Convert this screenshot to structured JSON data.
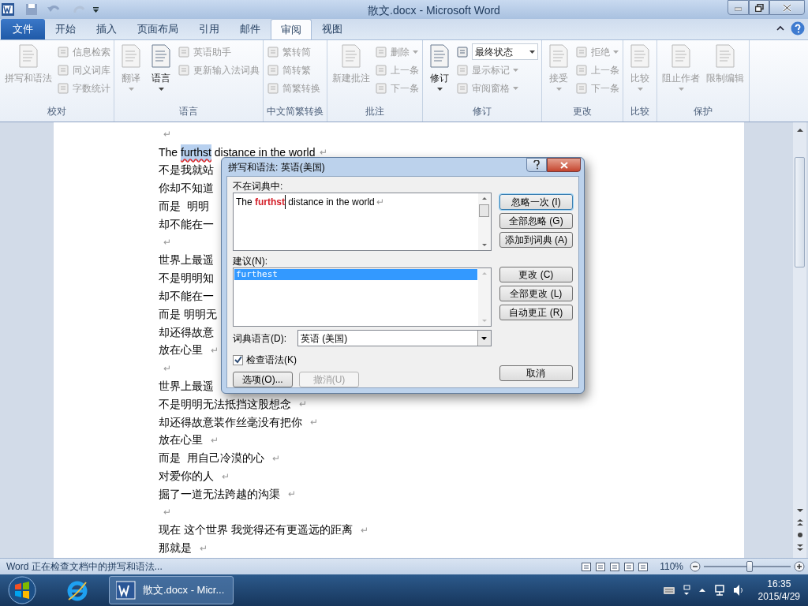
{
  "window": {
    "title": "散文.docx - Microsoft Word"
  },
  "tabs": [
    {
      "label": "文件",
      "kind": "file",
      "selected": false
    },
    {
      "label": "开始",
      "kind": "tab",
      "selected": false
    },
    {
      "label": "插入",
      "kind": "tab",
      "selected": false
    },
    {
      "label": "页面布局",
      "kind": "tab",
      "selected": false
    },
    {
      "label": "引用",
      "kind": "tab",
      "selected": false
    },
    {
      "label": "邮件",
      "kind": "tab",
      "selected": false
    },
    {
      "label": "审阅",
      "kind": "tab",
      "selected": true
    },
    {
      "label": "视图",
      "kind": "tab",
      "selected": false
    }
  ],
  "ribbon_groups": [
    {
      "label": "校对",
      "items": [
        {
          "label": "拼写和语法",
          "kind": "large",
          "disabled": true,
          "menu": false
        },
        {
          "label": "信息检索",
          "kind": "small",
          "disabled": true,
          "menu": false
        },
        {
          "label": "同义词库",
          "kind": "small",
          "disabled": true,
          "menu": false
        },
        {
          "label": "字数统计",
          "kind": "small",
          "disabled": true,
          "menu": false
        }
      ]
    },
    {
      "label": "语言",
      "items": [
        {
          "label": "翻译",
          "kind": "large",
          "disabled": true,
          "menu": true
        },
        {
          "label": "语言",
          "kind": "large",
          "disabled": false,
          "menu": true
        },
        {
          "label": "英语助手",
          "kind": "small",
          "disabled": true,
          "menu": false
        },
        {
          "label": "更新输入法词典",
          "kind": "small",
          "disabled": true,
          "menu": false
        }
      ]
    },
    {
      "label": "中文简繁转换",
      "items": [
        {
          "label": "繁转简",
          "kind": "small",
          "disabled": true,
          "menu": false
        },
        {
          "label": "简转繁",
          "kind": "small",
          "disabled": true,
          "menu": false
        },
        {
          "label": "简繁转换",
          "kind": "small",
          "disabled": true,
          "menu": false
        }
      ]
    },
    {
      "label": "批注",
      "items": [
        {
          "label": "新建批注",
          "kind": "large",
          "disabled": true,
          "menu": false
        },
        {
          "label": "删除",
          "kind": "small",
          "disabled": true,
          "menu": true
        },
        {
          "label": "上一条",
          "kind": "small",
          "disabled": true,
          "menu": false
        },
        {
          "label": "下一条",
          "kind": "small",
          "disabled": true,
          "menu": false
        }
      ]
    },
    {
      "label": "修订",
      "items": [
        {
          "label": "修订",
          "kind": "large",
          "disabled": false,
          "menu": true
        },
        {
          "label": "最终状态",
          "kind": "dropdown",
          "disabled": false,
          "menu": true
        },
        {
          "label": "显示标记",
          "kind": "small",
          "disabled": true,
          "menu": true
        },
        {
          "label": "审阅窗格",
          "kind": "small",
          "disabled": true,
          "menu": true
        }
      ]
    },
    {
      "label": "更改",
      "items": [
        {
          "label": "接受",
          "kind": "large",
          "disabled": true,
          "menu": true
        },
        {
          "label": "拒绝",
          "kind": "small",
          "disabled": true,
          "menu": true
        },
        {
          "label": "上一条",
          "kind": "small",
          "disabled": true,
          "menu": false
        },
        {
          "label": "下一条",
          "kind": "small",
          "disabled": true,
          "menu": false
        }
      ]
    },
    {
      "label": "比较",
      "items": [
        {
          "label": "比较",
          "kind": "large",
          "disabled": true,
          "menu": true
        }
      ]
    },
    {
      "label": "保护",
      "items": [
        {
          "label": "阻止作者",
          "kind": "large",
          "disabled": true,
          "menu": true
        },
        {
          "label": "限制编辑",
          "kind": "large",
          "disabled": true,
          "menu": false
        }
      ]
    }
  ],
  "document": {
    "lines": [
      {
        "kind": "plain",
        "mark": "↵"
      },
      {
        "kind": "error",
        "before": "The ",
        "error": "furthst",
        "after": " distance in the world",
        "mark": "↵"
      },
      {
        "kind": "plain",
        "text": "不是我就站"
      },
      {
        "kind": "plain",
        "text": "你却不知道"
      },
      {
        "kind": "plain",
        "text": "而是  明明"
      },
      {
        "kind": "plain",
        "text": "却不能在一"
      },
      {
        "kind": "plain",
        "mark": "↵"
      },
      {
        "kind": "plain",
        "text": "世界上最遥"
      },
      {
        "kind": "plain",
        "text": "不是明明知"
      },
      {
        "kind": "plain",
        "text": "却不能在一"
      },
      {
        "kind": "plain",
        "text": "而是 明明无"
      },
      {
        "kind": "plain",
        "text": "却还得故意"
      },
      {
        "kind": "plain",
        "text": "放在心里 ",
        "mark": "↵"
      },
      {
        "kind": "plain",
        "mark": "↵"
      },
      {
        "kind": "plain",
        "text": "世界上最遥"
      },
      {
        "kind": "plain",
        "text": "不是明明无法抵挡这股想念 ",
        "mark": "↵"
      },
      {
        "kind": "plain",
        "text": "却还得故意装作丝毫没有把你 ",
        "mark": "↵"
      },
      {
        "kind": "plain",
        "text": "放在心里 ",
        "mark": "↵"
      },
      {
        "kind": "plain",
        "text": "而是  用自己冷漠的心 ",
        "mark": "↵"
      },
      {
        "kind": "plain",
        "text": "对爱你的人 ",
        "mark": "↵"
      },
      {
        "kind": "plain",
        "text": "掘了一道无法跨越的沟渠 ",
        "mark": "↵"
      },
      {
        "kind": "plain",
        "mark": "↵"
      },
      {
        "kind": "plain",
        "text": "现在 这个世界 我觉得还有更遥远的距离 ",
        "mark": "↵"
      },
      {
        "kind": "plain",
        "text": "那就是 ",
        "mark": "↵"
      }
    ]
  },
  "dialog": {
    "title": "拼写和语法: 英语(美国)",
    "not_in_dictionary_label": "不在词典中:",
    "sentence": {
      "before": "The ",
      "error": "furthst",
      "after": " distance in the world",
      "mark": "↵"
    },
    "suggestions_label": "建议(N):",
    "suggestions": [
      {
        "text": "furthest",
        "selected": true
      }
    ],
    "dictionary_language_label": "词典语言(D):",
    "dictionary_language": "英语 (美国)",
    "check_grammar": {
      "label": "检查语法(K)",
      "checked": true
    },
    "side_buttons": [
      {
        "label": "忽略一次 (I)",
        "default": true
      },
      {
        "label": "全部忽略 (G)",
        "default": false
      },
      {
        "label": "添加到词典 (A)",
        "default": false
      }
    ],
    "change_buttons": [
      {
        "label": "更改 (C)",
        "default": false
      },
      {
        "label": "全部更改 (L)",
        "default": false
      },
      {
        "label": "自动更正 (R)",
        "default": false
      }
    ],
    "bottom_buttons": [
      {
        "label": "选项(O)...",
        "disabled": false
      },
      {
        "label": "撤消(U)",
        "disabled": true
      }
    ],
    "cancel_button": "取消"
  },
  "status_bar": {
    "message": "Word 正在检查文档中的拼写和语法...",
    "zoom": {
      "reading": "110%",
      "level": 0.53
    }
  },
  "taskbar": {
    "task": "散文.docx - Micr...",
    "time": "16:35",
    "date": "2015/4/29"
  }
}
